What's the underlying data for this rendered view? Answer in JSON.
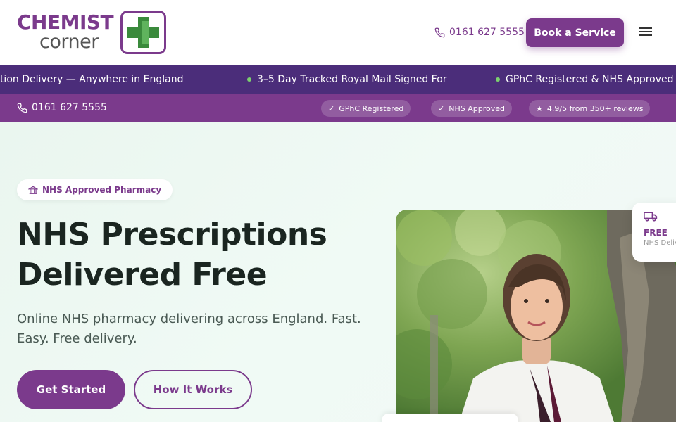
{
  "brand": {
    "line1": "CHEMIST",
    "line2": "corner",
    "primary_color": "#7b3a8c",
    "accent_color": "#3a8a3c"
  },
  "header": {
    "phone": "0161 627 5555",
    "book_label": "Book a Service",
    "menu_icon": "hamburger-icon"
  },
  "ticker": {
    "items": [
      "Free Prescription Delivery — Anywhere in England",
      "3–5 Day Tracked Royal Mail Signed For",
      "GPhC Registered & NHS Approved"
    ]
  },
  "infobar": {
    "phone": "0161 627 5555",
    "badges": [
      "GPhC Registered",
      "NHS Approved",
      "4.9/5 from 350+ reviews"
    ]
  },
  "hero": {
    "badge": "NHS Approved Pharmacy",
    "title_line1": "NHS Prescriptions",
    "title_line2": "Delivered Free",
    "subtitle": "Online NHS pharmacy delivering across England. Fast. Easy. Free delivery.",
    "primary_cta": "Get Started",
    "secondary_cta": "How It Works"
  },
  "delivery_card": {
    "title": "FREE",
    "subtitle": "NHS Delivery"
  }
}
